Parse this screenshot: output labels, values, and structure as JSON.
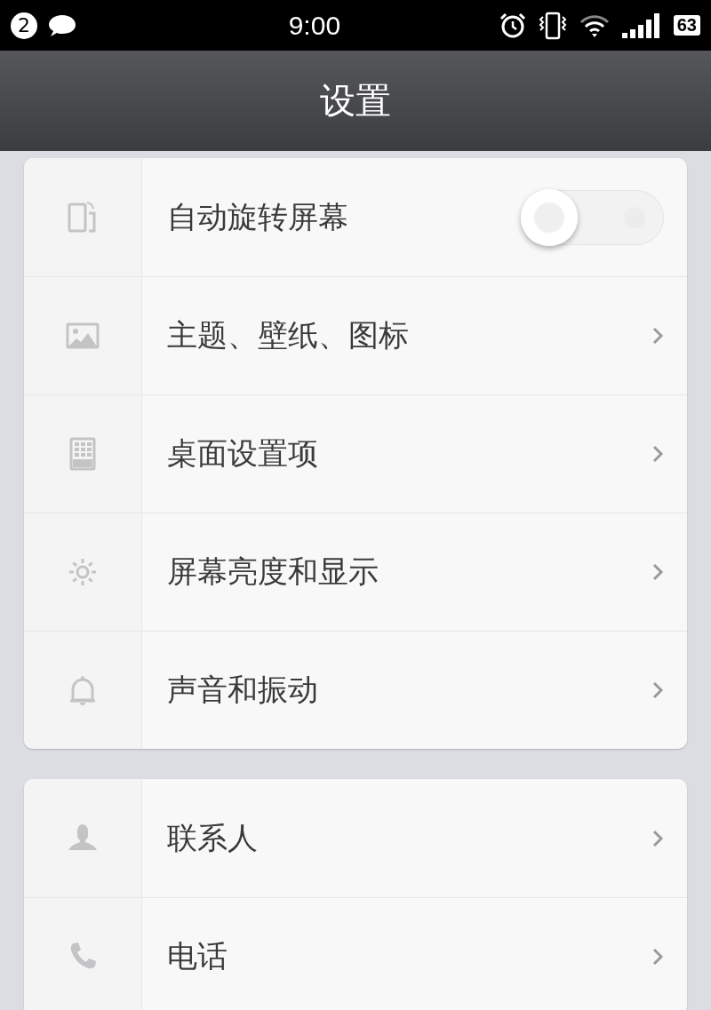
{
  "status_bar": {
    "notification_count": "2",
    "time": "9:00",
    "battery": "63"
  },
  "title": "设置",
  "groups": [
    {
      "rows": [
        {
          "kind": "toggle",
          "label": "自动旋转屏幕",
          "on": false
        },
        {
          "kind": "link",
          "label": "主题、壁纸、图标"
        },
        {
          "kind": "link",
          "label": "桌面设置项"
        },
        {
          "kind": "link",
          "label": "屏幕亮度和显示"
        },
        {
          "kind": "link",
          "label": "声音和振动"
        }
      ]
    },
    {
      "rows": [
        {
          "kind": "link",
          "label": "联系人"
        },
        {
          "kind": "link",
          "label": "电话"
        }
      ]
    }
  ]
}
